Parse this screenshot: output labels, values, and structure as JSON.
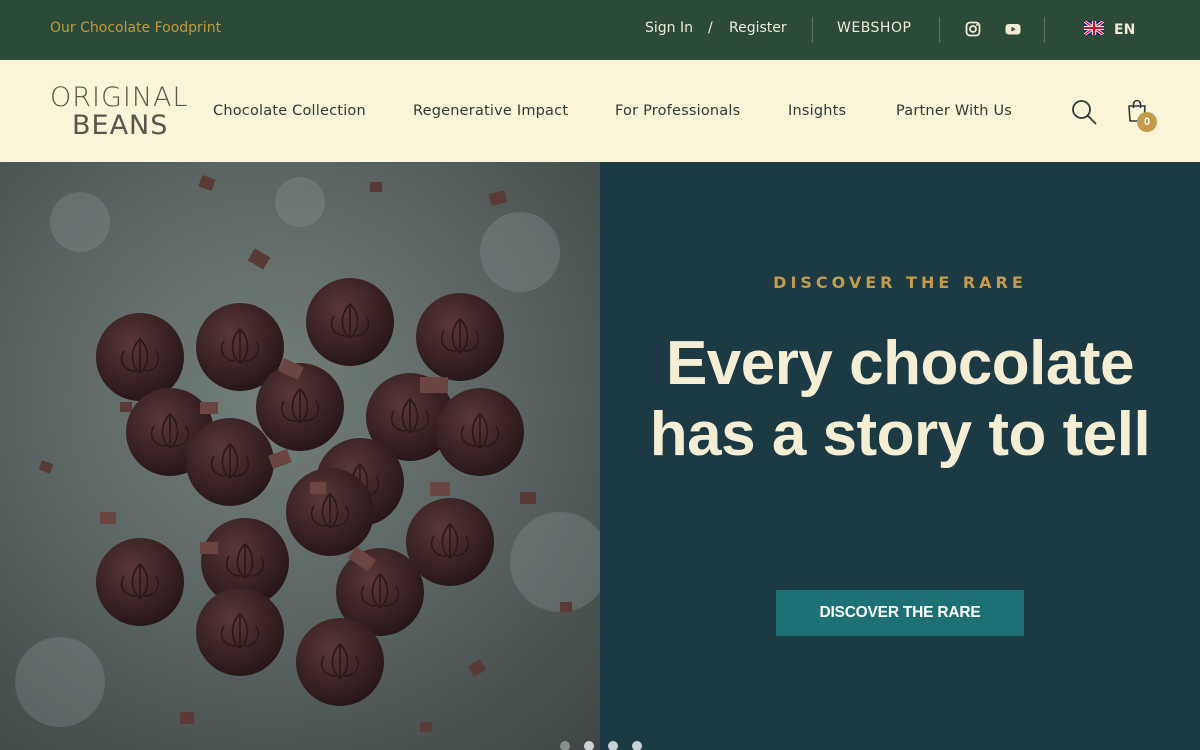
{
  "topbar": {
    "foodprint_link": "Our Chocolate Foodprint",
    "signin": "Sign In",
    "separator": "/",
    "register": "Register",
    "webshop": "WEBSHOP",
    "social": [
      "instagram-icon",
      "youtube-icon"
    ],
    "language": {
      "flag": "uk-flag-icon",
      "label": "EN"
    }
  },
  "header": {
    "logo": {
      "line1": "ORIGINAL",
      "line2": "BEANS"
    },
    "nav": [
      {
        "label": "Chocolate Collection"
      },
      {
        "label": "Regenerative Impact"
      },
      {
        "label": "For Professionals"
      },
      {
        "label": "Insights"
      },
      {
        "label": "Partner With Us"
      }
    ],
    "cart_count": "0"
  },
  "hero": {
    "eyebrow": "DISCOVER THE RARE",
    "headline": "Every chocolate has a story to tell",
    "cta": "DISCOVER THE RARE",
    "slides": 4,
    "active_slide": 1
  },
  "colors": {
    "topbar_bg": "#2b4a38",
    "header_bg": "#faf4d8",
    "panel_bg": "#1b3a43",
    "accent_gold": "#c49b4a",
    "cta_bg": "#1d7074",
    "headline_text": "#f5eed5"
  }
}
